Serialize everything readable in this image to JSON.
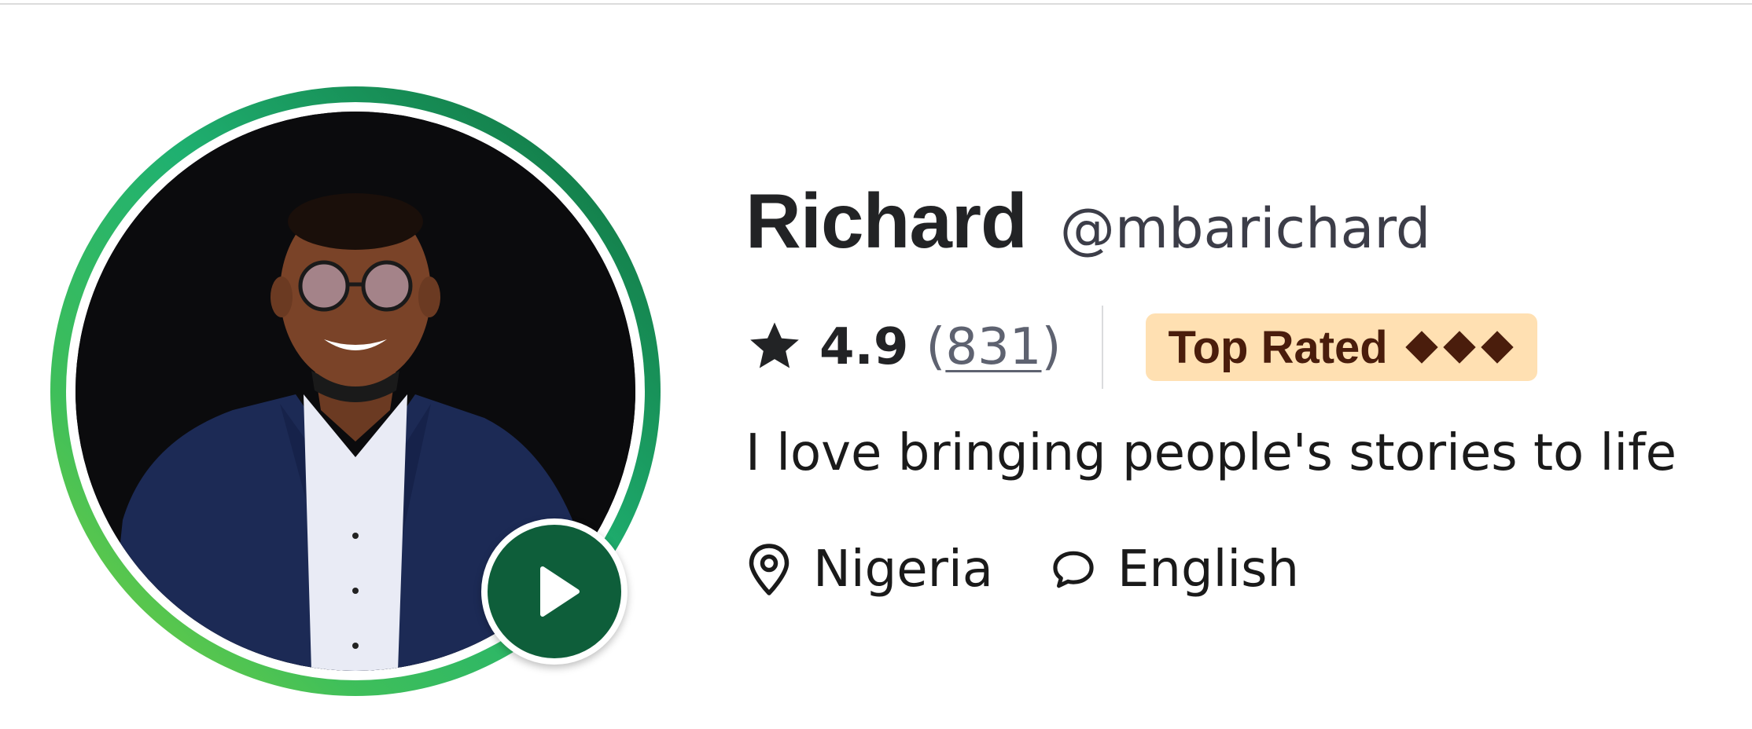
{
  "profile": {
    "name": "Richard",
    "handle": "@mbarichard",
    "rating": "4.9",
    "review_count_open": "(",
    "review_count": "831",
    "review_count_close": ")",
    "badge": {
      "label": "Top Rated",
      "diamonds": 3
    },
    "bio": "I love bringing people's stories to life",
    "location": "Nigeria",
    "language": "English"
  },
  "icons": {
    "star": "star-icon",
    "location": "location-pin-icon",
    "language": "speech-bubble-icon",
    "play": "play-icon",
    "diamond": "diamond-icon"
  },
  "colors": {
    "ring_start": "#0f6b3c",
    "ring_end": "#7fd13b",
    "play_button": "#0e5e3a",
    "badge_bg": "#ffe0b2",
    "badge_text": "#4a1d0c",
    "name_text": "#222325"
  }
}
